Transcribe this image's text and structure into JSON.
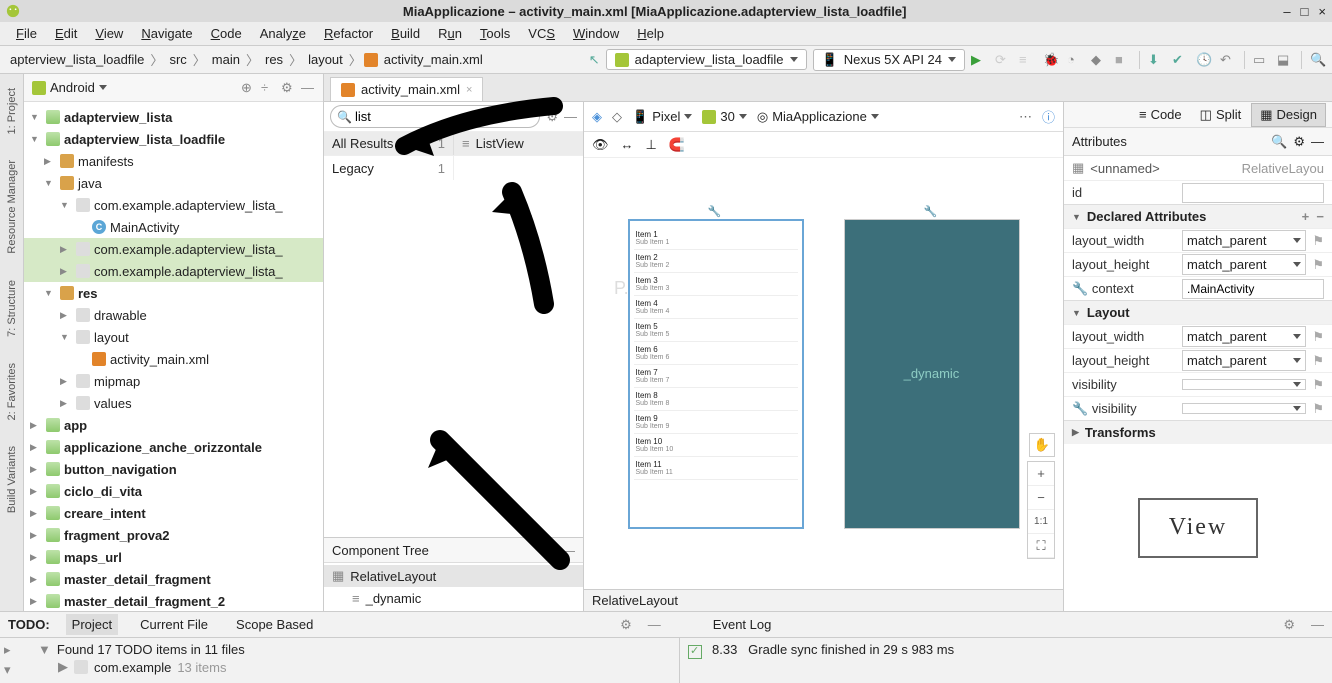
{
  "window": {
    "title": "MiaApplicazione – activity_main.xml [MiaApplicazione.adapterview_lista_loadfile]"
  },
  "menu": [
    "File",
    "Edit",
    "View",
    "Navigate",
    "Code",
    "Analyze",
    "Refactor",
    "Build",
    "Run",
    "Tools",
    "VCS",
    "Window",
    "Help"
  ],
  "breadcrumbs": [
    "apterview_lista_loadfile",
    "src",
    "main",
    "res",
    "layout",
    "activity_main.xml"
  ],
  "toolbar": {
    "runConfig": "adapterview_lista_loadfile",
    "device": "Nexus 5X API 24"
  },
  "projectPanel": {
    "title": "Android"
  },
  "tree": [
    {
      "l": 0,
      "arrow": "▼",
      "icon": "module",
      "label": "adapterview_lista",
      "bold": true
    },
    {
      "l": 0,
      "arrow": "▼",
      "icon": "module",
      "label": "adapterview_lista_loadfile",
      "bold": true,
      "selected": false
    },
    {
      "l": 1,
      "arrow": "▶",
      "icon": "folder",
      "label": "manifests"
    },
    {
      "l": 1,
      "arrow": "▼",
      "icon": "folder",
      "label": "java"
    },
    {
      "l": 2,
      "arrow": "▼",
      "icon": "pkg",
      "label": "com.example.adapterview_lista_"
    },
    {
      "l": 3,
      "arrow": "",
      "icon": "class-c",
      "label": "MainActivity"
    },
    {
      "l": 2,
      "arrow": "▶",
      "icon": "pkg",
      "label": "com.example.adapterview_lista_",
      "selected": true
    },
    {
      "l": 2,
      "arrow": "▶",
      "icon": "pkg",
      "label": "com.example.adapterview_lista_",
      "selected": true
    },
    {
      "l": 1,
      "arrow": "▼",
      "icon": "folder",
      "label": "res",
      "bold": true
    },
    {
      "l": 2,
      "arrow": "▶",
      "icon": "pkg",
      "label": "drawable"
    },
    {
      "l": 2,
      "arrow": "▼",
      "icon": "pkg",
      "label": "layout"
    },
    {
      "l": 3,
      "arrow": "",
      "icon": "xml",
      "label": "activity_main.xml"
    },
    {
      "l": 2,
      "arrow": "▶",
      "icon": "pkg",
      "label": "mipmap"
    },
    {
      "l": 2,
      "arrow": "▶",
      "icon": "pkg",
      "label": "values"
    },
    {
      "l": 0,
      "arrow": "▶",
      "icon": "module",
      "label": "app",
      "bold": true
    },
    {
      "l": 0,
      "arrow": "▶",
      "icon": "module",
      "label": "applicazione_anche_orizzontale",
      "bold": true
    },
    {
      "l": 0,
      "arrow": "▶",
      "icon": "module",
      "label": "button_navigation",
      "bold": true
    },
    {
      "l": 0,
      "arrow": "▶",
      "icon": "module",
      "label": "ciclo_di_vita",
      "bold": true
    },
    {
      "l": 0,
      "arrow": "▶",
      "icon": "module",
      "label": "creare_intent",
      "bold": true
    },
    {
      "l": 0,
      "arrow": "▶",
      "icon": "module",
      "label": "fragment_prova2",
      "bold": true
    },
    {
      "l": 0,
      "arrow": "▶",
      "icon": "module",
      "label": "maps_url",
      "bold": true
    },
    {
      "l": 0,
      "arrow": "▶",
      "icon": "module",
      "label": "master_detail_fragment",
      "bold": true
    },
    {
      "l": 0,
      "arrow": "▶",
      "icon": "module",
      "label": "master_detail_fragment_2",
      "bold": true
    }
  ],
  "editor": {
    "tab": "activity_main.xml"
  },
  "viewModes": {
    "code": "Code",
    "split": "Split",
    "design": "Design"
  },
  "palette": {
    "search": "list",
    "allResults": "All Results",
    "allResultsCount": "1",
    "listView": "ListView",
    "legacy": "Legacy",
    "legacyCount": "1"
  },
  "componentTree": {
    "title": "Component Tree",
    "root": "RelativeLayout",
    "child": "_dynamic"
  },
  "canvas": {
    "pixel": "Pixel",
    "api": "30",
    "appTheme": "MiaApplicazione",
    "watermark": "P. Carafizio Algo",
    "blueprintText": "_dynamic",
    "zoom11": "1:1",
    "listItems": [
      {
        "t": "Item 1",
        "s": "Sub Item 1"
      },
      {
        "t": "Item 2",
        "s": "Sub Item 2"
      },
      {
        "t": "Item 3",
        "s": "Sub Item 3"
      },
      {
        "t": "Item 4",
        "s": "Sub Item 4"
      },
      {
        "t": "Item 5",
        "s": "Sub Item 5"
      },
      {
        "t": "Item 6",
        "s": "Sub Item 6"
      },
      {
        "t": "Item 7",
        "s": "Sub Item 7"
      },
      {
        "t": "Item 8",
        "s": "Sub Item 8"
      },
      {
        "t": "Item 9",
        "s": "Sub Item 9"
      },
      {
        "t": "Item 10",
        "s": "Sub Item 10"
      },
      {
        "t": "Item 11",
        "s": "Sub Item 11"
      }
    ]
  },
  "attributes": {
    "title": "Attributes",
    "elementName": "<unnamed>",
    "elementType": "RelativeLayou",
    "idLabel": "id",
    "sections": {
      "declared": "Declared Attributes",
      "layout": "Layout",
      "transforms": "Transforms"
    },
    "rows": {
      "layout_width": "layout_width",
      "layout_height": "layout_height",
      "context": "context",
      "visibility": "visibility",
      "toolsVisibility": "visibility"
    },
    "values": {
      "layout_width": "match_parent",
      "layout_height": "match_parent",
      "context": ".MainActivity",
      "layout_width2": "match_parent",
      "layout_height2": "match_parent"
    },
    "viewBoxText": "View"
  },
  "statusBreadcrumb": "RelativeLayout",
  "bottom": {
    "todoTitle": "TODO:",
    "tabs": [
      "Project",
      "Current File",
      "Scope Based"
    ],
    "eventTitle": "Event Log",
    "todoLine1": "Found 17 TODO items in 11 files",
    "todoLine2a": "com.example",
    "todoLine2b": "13 items",
    "eventTime": "8.33",
    "eventMsg": "Gradle sync finished in 29 s 983 ms"
  },
  "gutter": {
    "project": "1: Project",
    "resource": "Resource Manager",
    "structure": "7: Structure",
    "favorites": "2: Favorites",
    "build": "Build Variants"
  }
}
